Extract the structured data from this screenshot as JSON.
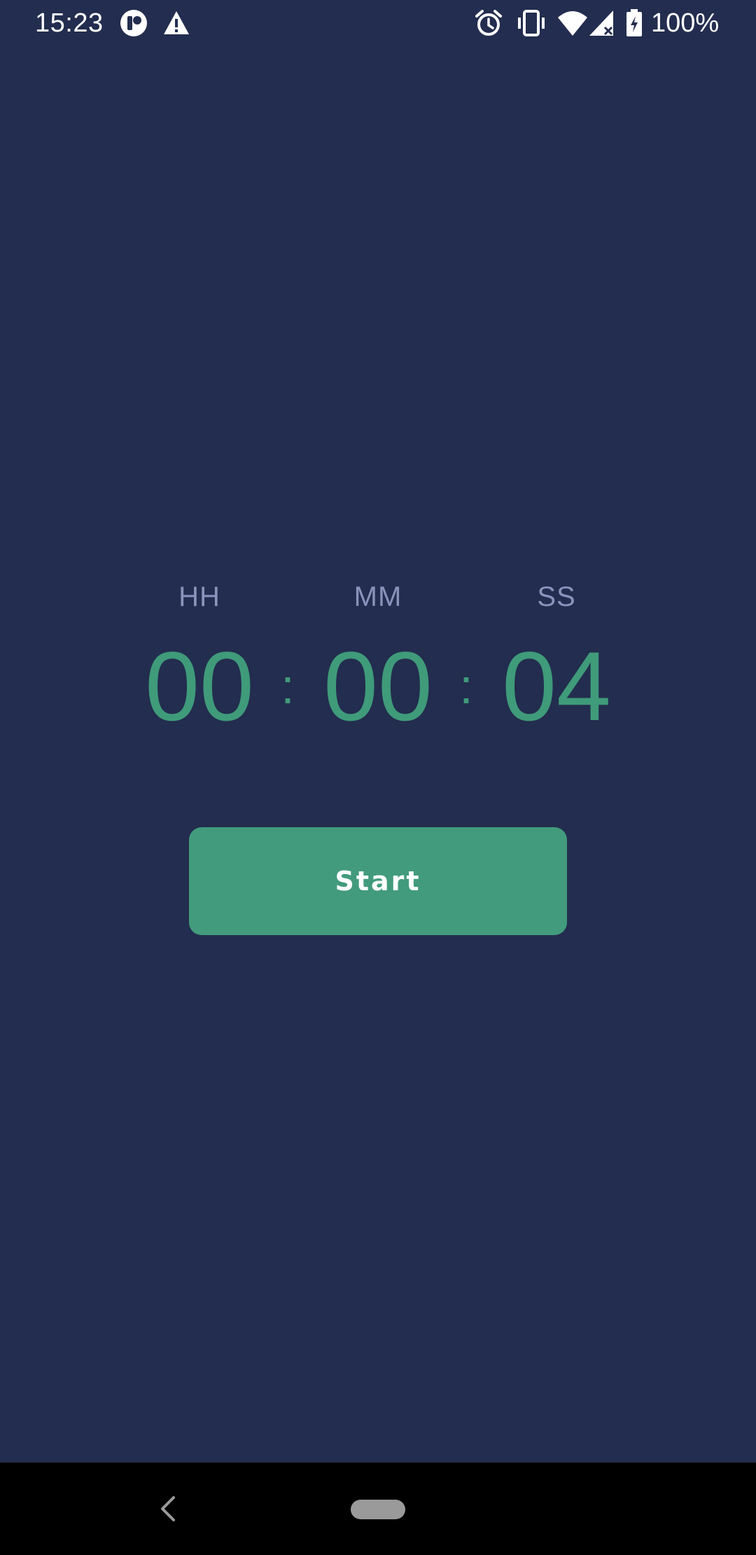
{
  "status_bar": {
    "time": "15:23",
    "icons": [
      "app-notification-icon",
      "warning-icon",
      "alarm-icon",
      "vibrate-icon",
      "wifi-icon",
      "signal-icon",
      "battery-icon"
    ],
    "battery_text": "100%"
  },
  "timer": {
    "labels": {
      "hours": "HH",
      "minutes": "MM",
      "seconds": "SS"
    },
    "values": {
      "hours": "00",
      "minutes": "00",
      "seconds": "04"
    },
    "separator": ":"
  },
  "actions": {
    "start_label": "Start"
  },
  "colors": {
    "background": "#232d4f",
    "accent": "#3f9b7a",
    "button": "#429b7c",
    "label": "#8a93bb"
  },
  "navigation": {
    "icons": [
      "back-icon",
      "home-pill"
    ]
  }
}
